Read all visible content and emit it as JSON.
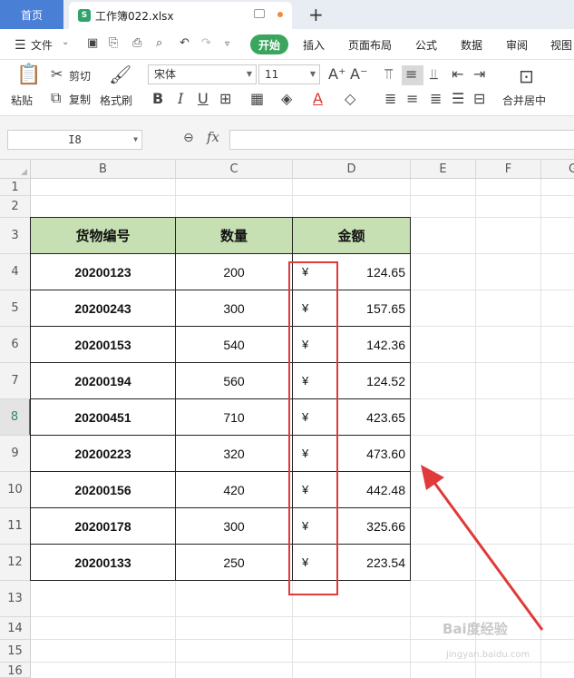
{
  "titlebar": {
    "home_tab": "首页",
    "file_tab": "工作簿022.xlsx",
    "file_icon_letter": "S"
  },
  "menubar": {
    "file_menu": "文件",
    "start": "开始",
    "items": [
      "插入",
      "页面布局",
      "公式",
      "数据",
      "审阅",
      "视图"
    ]
  },
  "ribbon": {
    "paste": "粘贴",
    "cut": "剪切",
    "copy": "复制",
    "format_painter": "格式刷",
    "font_name": "宋体",
    "font_size": "11",
    "merge_center": "合并居中"
  },
  "formulabar": {
    "name_box": "I8",
    "fx": "fx",
    "formula": ""
  },
  "columns": [
    "B",
    "C",
    "D",
    "E",
    "F",
    "G"
  ],
  "rows": [
    "1",
    "2",
    "3",
    "4",
    "5",
    "6",
    "7",
    "8",
    "9",
    "10",
    "11",
    "12",
    "13",
    "14",
    "15",
    "16"
  ],
  "active_row": "8",
  "table": {
    "headers": [
      "货物编号",
      "数量",
      "金额"
    ],
    "currency_symbol": "¥",
    "rows": [
      {
        "id": "20200123",
        "qty": "200",
        "amount": "124.65"
      },
      {
        "id": "20200243",
        "qty": "300",
        "amount": "157.65"
      },
      {
        "id": "20200153",
        "qty": "540",
        "amount": "142.36"
      },
      {
        "id": "20200194",
        "qty": "560",
        "amount": "124.52"
      },
      {
        "id": "20200451",
        "qty": "710",
        "amount": "423.65"
      },
      {
        "id": "20200223",
        "qty": "320",
        "amount": "473.60"
      },
      {
        "id": "20200156",
        "qty": "420",
        "amount": "442.48"
      },
      {
        "id": "20200178",
        "qty": "300",
        "amount": "325.66"
      },
      {
        "id": "20200133",
        "qty": "250",
        "amount": "223.54"
      }
    ]
  },
  "colors": {
    "header_fill": "#c6e0b4",
    "highlight": "#e03a3a",
    "start_button": "#3aa55c"
  },
  "watermark": {
    "main": "Bai度经验",
    "sub": "jingyan.baidu.com"
  }
}
